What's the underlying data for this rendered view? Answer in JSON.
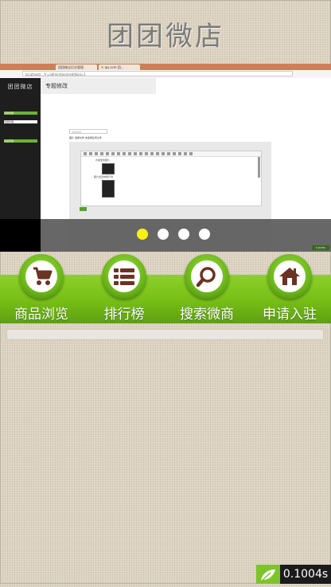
{
  "header": {
    "title": "团团微店"
  },
  "slider": {
    "browser_tabs": [
      "团团微店后台管理",
      "✕ qq.com 团…"
    ],
    "address": "localhost/...?r=admin/topic/edit&id=1",
    "admin_logo": "团团微店",
    "side_menu": [
      "系统管理",
      "专题管理",
      "商品管理"
    ],
    "page_heading": "专题修改",
    "input_placeholder": "专题名称",
    "upload_label": "图片 选择文件 未选择任何文件",
    "editor_captions": [
      "内容里的图片",
      "图片加载效果示例"
    ],
    "status_text": "0.0135s",
    "dots": [
      {
        "active": true
      },
      {
        "active": false
      },
      {
        "active": false
      },
      {
        "active": false
      }
    ]
  },
  "nav": {
    "items": [
      {
        "label": "商品浏览",
        "icon": "stroller-icon"
      },
      {
        "label": "排行榜",
        "icon": "list-icon"
      },
      {
        "label": "搜索微商",
        "icon": "search-icon"
      },
      {
        "label": "申请入驻",
        "icon": "home-icon"
      }
    ]
  },
  "timer": {
    "value": "0.1004s"
  },
  "colors": {
    "green": "#76be16",
    "dot_active": "#ffef10",
    "icon_brown": "#6b3323"
  }
}
